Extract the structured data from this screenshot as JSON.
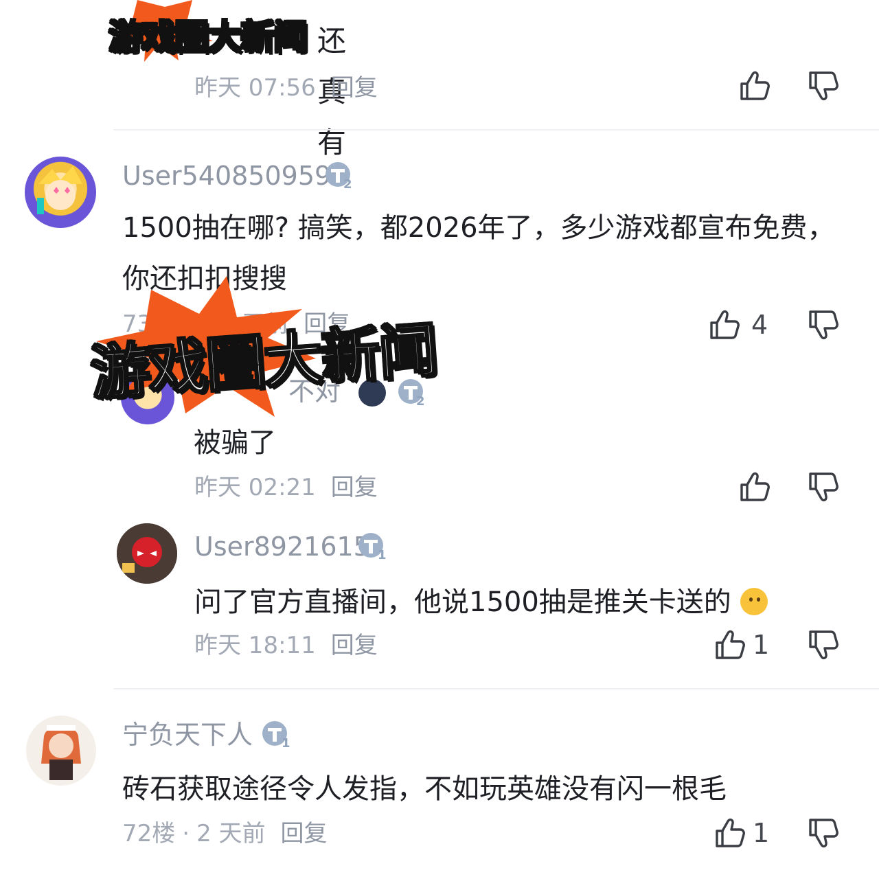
{
  "comments": {
    "top_reply": {
      "content_fragment": "还真有",
      "time": "昨天 07:56",
      "reply": "回复"
    },
    "c1": {
      "username": "User540850959",
      "level": "2",
      "content": "1500抽在哪? 搞笑，都2026年了，多少游戏都宣布免费，你还扣扣搜搜",
      "floor": "73",
      "time": "天前",
      "reply": "回复",
      "likes": "4"
    },
    "c1_reply1": {
      "username_fragment": "不对",
      "level": "2",
      "content": "被骗了",
      "time": "昨天 02:21",
      "reply": "回复"
    },
    "c1_reply2": {
      "username": "User8921615",
      "level": "1",
      "content": "问了官方直播间，他说1500抽是推关卡送的",
      "time": "昨天 18:11",
      "reply": "回复",
      "likes": "1"
    },
    "c2": {
      "username": "宁负天下人",
      "level": "1",
      "content": "砖石获取途径令人发指，不如玩英雄没有闪一根毛",
      "floor": "72楼",
      "separator": "·",
      "time": "2 天前",
      "reply": "回复",
      "likes": "1"
    }
  },
  "watermark": {
    "small": "游戏圈大新闻",
    "large": "游戏圈大新闻",
    "burst_color": "#f25a1d"
  },
  "colors": {
    "name": "#8f96a3",
    "text": "#1d1f24",
    "meta": "#a3a9b4",
    "badge": "#8fa3bd"
  },
  "icons": [
    "thumbs-up-icon",
    "thumbs-down-icon",
    "level-badge-icon",
    "emoji-icon"
  ]
}
